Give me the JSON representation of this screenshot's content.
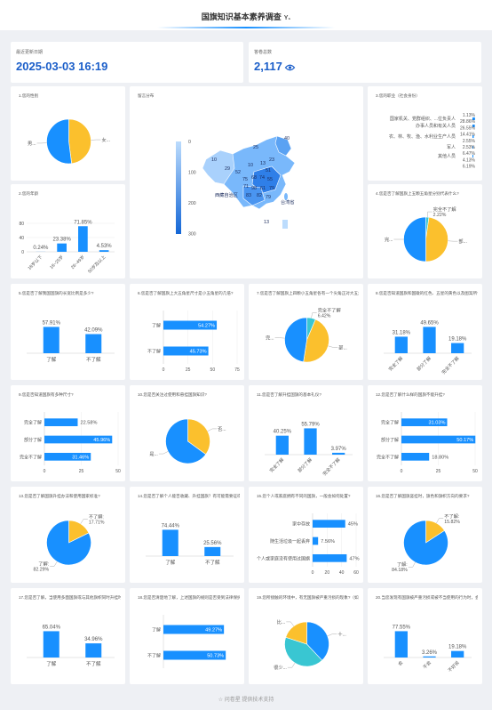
{
  "page": {
    "title": "国旗知识基本素养调查",
    "title_tag": "Y₁",
    "footer": "问卷星 提供技术支持"
  },
  "stats": {
    "last_update_label": "最近更新日期",
    "last_update_value": "2025-03-03 16:19",
    "answers_label": "答卷总数",
    "answers_value": "2,117"
  },
  "colors": {
    "blue": "#1890ff",
    "yellow": "#fbc02d",
    "cyan": "#39c6d2",
    "grid": "#e8e8e8"
  },
  "chart_data": [
    {
      "type": "pie",
      "title": "1.您的性别",
      "labels": [
        "女...",
        "男..."
      ],
      "values": [
        48,
        52
      ]
    },
    {
      "type": "map",
      "title": "留言分布",
      "legend_ticks": [
        "0",
        "100",
        "200",
        "300"
      ],
      "region_labels": [
        "40",
        "25",
        "10",
        "29",
        "52",
        "10",
        "13",
        "23",
        "51",
        "75",
        "68",
        "74",
        "55",
        "71",
        "98",
        "61",
        "79",
        "83",
        "82",
        "79",
        "13"
      ],
      "place_names": [
        "西藏自治区",
        "台湾省"
      ]
    },
    {
      "type": "bar",
      "orientation": "horizontal",
      "title": "3.您的职业（社会身份）",
      "categories": [
        "国家机关、党群组织、...位负责人",
        "办事人员和有关人员",
        "农、林、牧、渔、水利业生产人员",
        "军人",
        "其他人员"
      ],
      "values": [
        28.86,
        26.55,
        14.41,
        6.47,
        4.13
      ],
      "value_labels": [
        "1.13%",
        "28.86%",
        "26.55%",
        "14.41%",
        "2.55%",
        "2.53%",
        "6.47%",
        "4.13%",
        "6.19%"
      ]
    },
    {
      "type": "bar",
      "title": "2.您的年龄",
      "categories": [
        "18岁以下",
        "18~25岁",
        "26~49岁",
        "50岁及以上"
      ],
      "values": [
        0.24,
        23.38,
        71.85,
        4.53
      ],
      "ylim": [
        0,
        80
      ],
      "yticks": [
        "0",
        "40",
        "80"
      ]
    },
    {
      "type": "pie",
      "title": "4.您是否了解国旗上五颗五角星分别代表什么?",
      "labels": [
        "完全不了解",
        "部...",
        "完..."
      ],
      "values": [
        2.22,
        47.78,
        50
      ]
    },
    {
      "type": "bar",
      "title": "5.您是否了解我国国旗的长宽比例是多少?",
      "categories": [
        "了解",
        "不了解"
      ],
      "values": [
        57.91,
        42.09
      ]
    },
    {
      "type": "bar",
      "orientation": "horizontal",
      "title": "6.您是否了解国旗上大五角星尺寸是小五角星的几倍?",
      "categories": [
        "了解",
        "不了解"
      ],
      "values": [
        54.27,
        45.73
      ],
      "xticks": [
        "0",
        "25",
        "50",
        "75"
      ]
    },
    {
      "type": "pie",
      "title": "7.您是否了解国旗上四颗小五角星各有一个尖角正对大五角星的中心点?",
      "labels": [
        "完全不了解",
        "部...",
        "完..."
      ],
      "values": [
        6.42,
        46,
        47.58
      ]
    },
    {
      "type": "bar",
      "title": "8.您是否知道国旗和国徽的红色、五星的黄色以及图案所代表的含义?",
      "categories": [
        "完全了解",
        "部分了解",
        "完全不了解"
      ],
      "values": [
        31.18,
        49.65,
        19.18
      ]
    },
    {
      "type": "bar",
      "orientation": "horizontal",
      "title": "9.您是否知道国旗有多种尺寸?",
      "categories": [
        "完全了解",
        "部分了解",
        "完全不了解"
      ],
      "values": [
        22.58,
        45.96,
        31.46
      ],
      "xticks": [
        "0",
        "25",
        "50"
      ]
    },
    {
      "type": "pie",
      "title": "10.您是否关注过使用和悬挂国旗知识?",
      "labels": [
        "否...",
        "是..."
      ],
      "values": [
        35,
        65
      ]
    },
    {
      "type": "bar",
      "title": "11.您是否了解升挂国旗的基本礼仪?",
      "categories": [
        "完全了解",
        "部分了解",
        "完全不了解"
      ],
      "values": [
        40.25,
        55.79,
        3.97
      ]
    },
    {
      "type": "bar",
      "orientation": "horizontal",
      "title": "12.您是否了解什么样的国旗不能升挂?",
      "categories": [
        "完全了解",
        "部分了解",
        "完全不了解"
      ],
      "values": [
        31.03,
        50.17,
        18.8
      ],
      "xticks": [
        "0",
        "25",
        "50"
      ]
    },
    {
      "type": "pie",
      "title": "13.您是否了解国旗升挂办法和使用国家标准?",
      "labels": [
        "不了解:",
        "了解:"
      ],
      "values": [
        17.71,
        82.29
      ]
    },
    {
      "type": "bar",
      "title": "14.您是否了解个人能否收藏、升挂国旗？有可能需要征得同意吗?",
      "categories": [
        "了解",
        "不了解"
      ],
      "values": [
        74.44,
        25.56
      ]
    },
    {
      "type": "bar",
      "orientation": "horizontal",
      "title": "15.您个人或家庭拥有不同的国旗，一般会如何处置?",
      "categories": [
        "家中存放",
        "随生活垃圾一起丢弃",
        "个人或家庭没有使用过国旗"
      ],
      "values": [
        45.0,
        7.56,
        47.0
      ],
      "value_labels": [
        "45%",
        "7.56%",
        "47%"
      ],
      "xticks": [
        "0",
        "20",
        "40",
        "60"
      ]
    },
    {
      "type": "pie",
      "title": "16.您是否了解国旗竖挂时，旗色和旗帜方向的要求?",
      "labels": [
        "不了解:",
        "了解:"
      ],
      "values": [
        15.82,
        84.18
      ]
    },
    {
      "type": "bar",
      "title": "17.您是否了解，当使用多面国旗或与其他旗帜同时升挂时的排列规则?",
      "categories": [
        "了解",
        "不了解"
      ],
      "values": [
        65.04,
        34.96
      ]
    },
    {
      "type": "bar",
      "orientation": "horizontal",
      "title": "18.您是否清楚地了解，上述国旗的规则是否受到法律保护?",
      "categories": [
        "了解",
        "不了解"
      ],
      "values": [
        49.27,
        50.73
      ]
    },
    {
      "type": "pie",
      "title": "19.您所接触的环境中，有无国旗被严重污损的现象?（如）",
      "labels": [
        "十...",
        "很少...",
        "比..."
      ],
      "values": [
        38,
        42,
        20
      ]
    },
    {
      "type": "bar",
      "title": "20.当您发现有国旗被严重污损或被不当使用的行为时，会采取何种做法?",
      "categories": [
        "会",
        "不会",
        "不好说"
      ],
      "values": [
        77.55,
        3.26,
        19.18
      ]
    }
  ]
}
